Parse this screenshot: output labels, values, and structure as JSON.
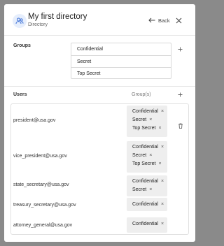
{
  "header": {
    "title": "My first directory",
    "subtitle": "Directory",
    "back_label": "Back"
  },
  "groups_section": {
    "label": "Groups",
    "items": [
      "Confidential",
      "Secret",
      "Top Secret"
    ]
  },
  "users_section": {
    "label": "Users",
    "groups_column_label": "Group(s)",
    "users": [
      {
        "email": "president@usa.gov",
        "groups": [
          "Confidential",
          "Secret",
          "Top Secret"
        ]
      },
      {
        "email": "vice_president@usa.gov",
        "groups": [
          "Confidential",
          "Secret",
          "Top Secret"
        ]
      },
      {
        "email": "state_secretary@usa.gov",
        "groups": [
          "Confidential",
          "Secret"
        ]
      },
      {
        "email": "treasury_secretary@usa.gov",
        "groups": [
          "Confidential"
        ]
      },
      {
        "email": "attorney_general@usa.gov",
        "groups": [
          "Confidential"
        ]
      }
    ]
  },
  "icons": {
    "chip_remove": "×",
    "add": "+"
  }
}
